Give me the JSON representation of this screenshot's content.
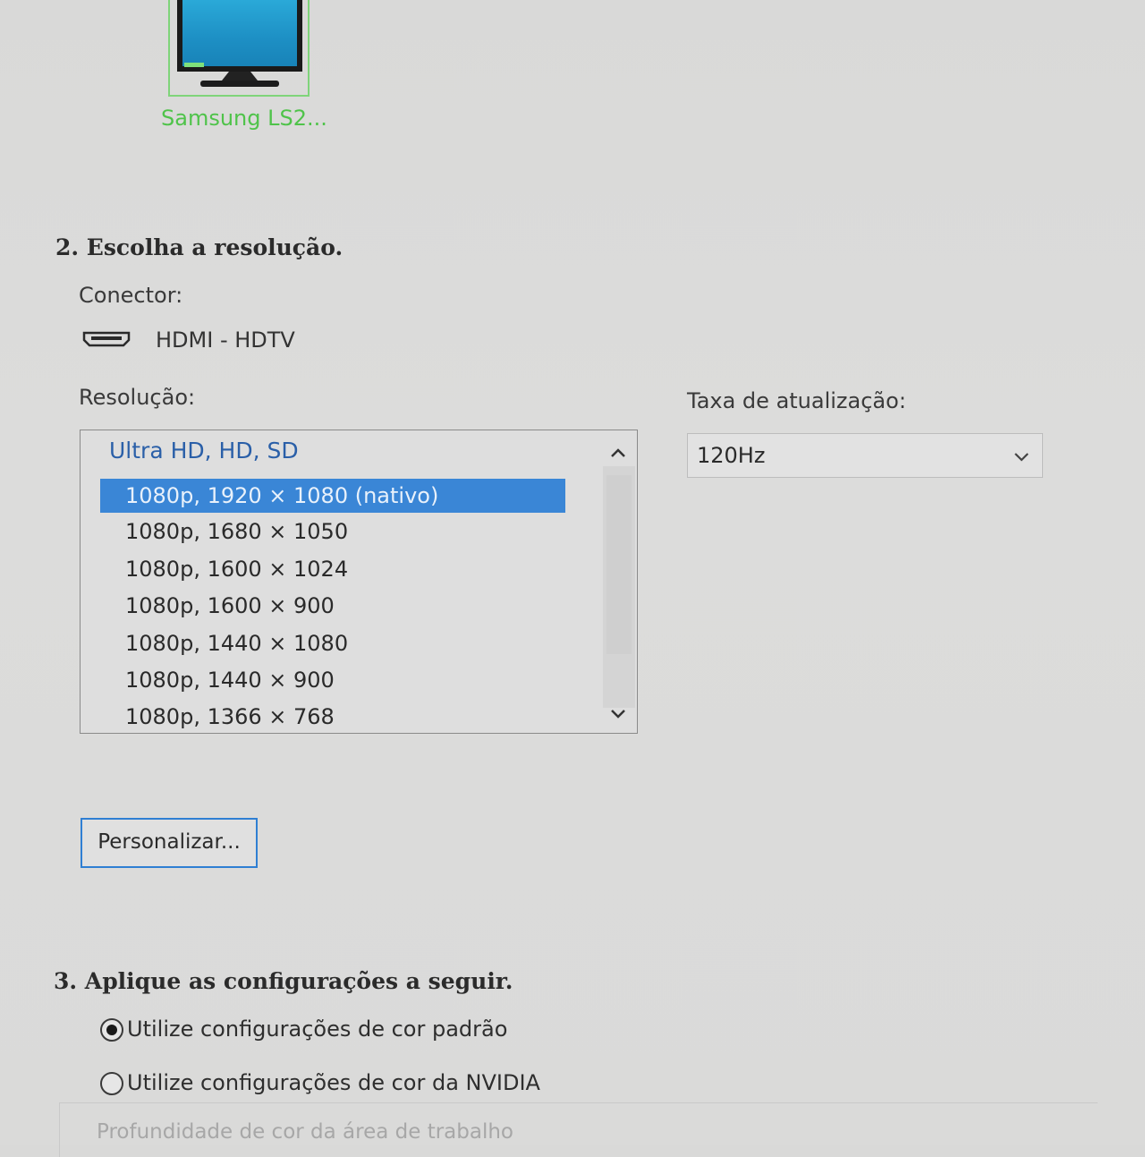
{
  "monitor": {
    "label": "Samsung LS2..."
  },
  "section2": {
    "title": "2. Escolha a resolução.",
    "connector_label": "Conector:",
    "connector_value": "HDMI - HDTV",
    "resolution_label": "Resolução:",
    "group_header": "Ultra HD, HD, SD",
    "resolutions": [
      "1080p, 1920 × 1080 (nativo)",
      "1080p, 1680 × 1050",
      "1080p, 1600 × 1024",
      "1080p, 1600 × 900",
      "1080p, 1440 × 1080",
      "1080p, 1440 × 900",
      "1080p, 1366 × 768"
    ],
    "selected_index": 0,
    "refresh_label": "Taxa de atualização:",
    "refresh_value": "120Hz",
    "customize_button": "Personalizar..."
  },
  "section3": {
    "title": "3. Aplique as configurações a seguir.",
    "radio_default": "Utilize configurações de cor padrão",
    "radio_nvidia": "Utilize configurações de cor da NVIDIA",
    "depth_label": "Profundidade de cor da área de trabalho"
  },
  "colors": {
    "accent": "#3a86d6",
    "selection": "#3a86d6",
    "monitor_green": "#4fc34a"
  }
}
